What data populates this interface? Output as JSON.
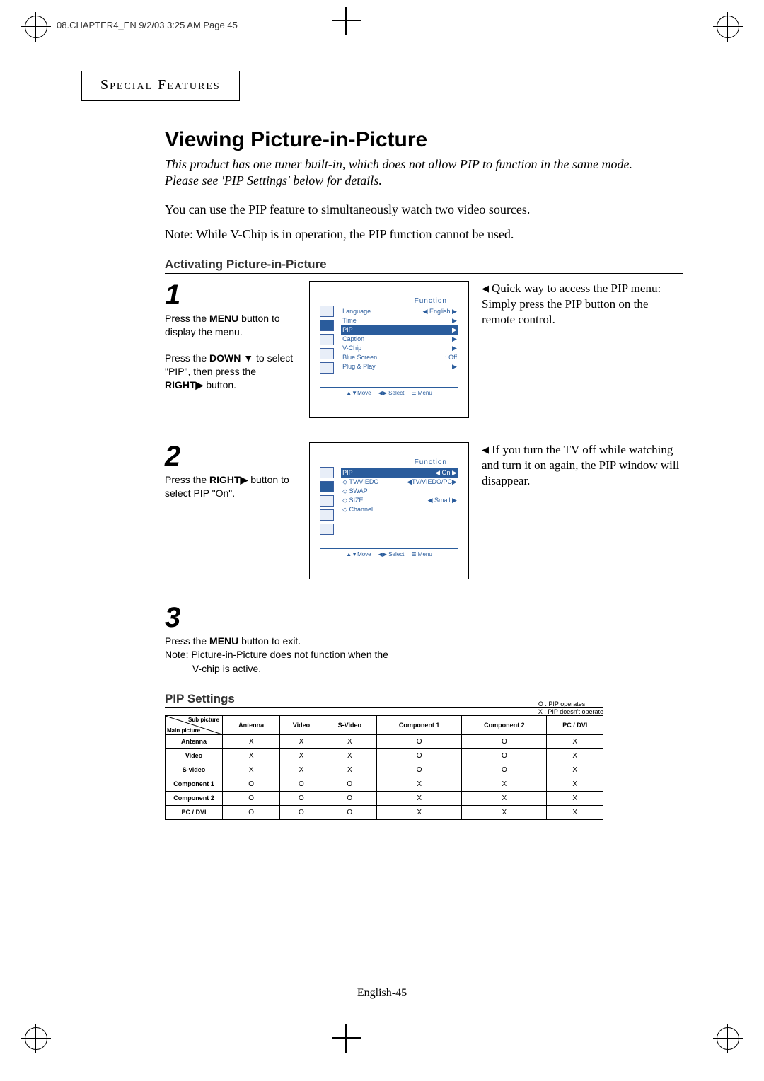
{
  "print_header": "08.CHAPTER4_EN  9/2/03 3:25 AM  Page 45",
  "section_label": "Special Features",
  "title": "Viewing Picture-in-Picture",
  "intro_italic": "This product has one tuner built-in, which does not allow PIP to function in the same mode. Please see 'PIP Settings' below for details.",
  "intro_1": "You can use the PIP feature to simultaneously watch two video sources.",
  "intro_2": "Note:  While V-Chip is in operation, the PIP function cannot be used.",
  "subhead_activate": "Activating Picture-in-Picture",
  "step1": {
    "num": "1",
    "text_a": "Press the ",
    "bold_a": "MENU",
    "text_b": " button to display the menu.",
    "text_c": "Press the ",
    "bold_c": "DOWN ▼",
    "text_d": "to select \"PIP\", then press the ",
    "bold_d": "RIGHT▶",
    "text_e": " button.",
    "osd_title": "Function",
    "osd_rows": [
      {
        "l": "Language",
        "r": "◀ English ▶"
      },
      {
        "l": "Time",
        "r": "▶"
      },
      {
        "l": "PIP",
        "r": "▶",
        "sel": true
      },
      {
        "l": "Caption",
        "r": "▶"
      },
      {
        "l": "V-Chip",
        "r": "▶"
      },
      {
        "l": "Blue Screen",
        "r": ": Off"
      },
      {
        "l": "Plug & Play",
        "r": "▶"
      }
    ],
    "osd_footer": {
      "a": "▲▼Move",
      "b": "◀▶ Select",
      "c": "☰ Menu"
    }
  },
  "tip1": "Quick way to access the PIP menu: Simply press the PIP button on the remote control.",
  "step2": {
    "num": "2",
    "text_a": "Press the ",
    "bold_a": "RIGHT▶",
    "text_b": " button to select PIP \"On\".",
    "osd_title": "Function",
    "osd_rows": [
      {
        "l": "PIP",
        "r": "◀   On   ▶",
        "sel": true
      },
      {
        "l": "◇ TV/VIEDO",
        "r": "◀TV/VIEDO/PC▶"
      },
      {
        "l": "◇ SWAP",
        "r": ""
      },
      {
        "l": "◇ SIZE",
        "r": "◀   Small   ▶"
      },
      {
        "l": "◇ Channel",
        "r": ""
      }
    ],
    "osd_footer": {
      "a": "▲▼Move",
      "b": "◀▶ Select",
      "c": "☰ Menu"
    }
  },
  "tip2": "If you turn the TV off while watching and turn it on again, the PIP window will disappear.",
  "step3": {
    "num": "3",
    "line1_a": "Press the ",
    "line1_bold": "MENU",
    "line1_b": " button to exit.",
    "line2": "Note: Picture-in-Picture does not function when the",
    "line3": "          V-chip is active."
  },
  "subhead_settings": "PIP Settings",
  "legend_o": "O :   PIP operates",
  "legend_x": "X :   PIP doesn't operate",
  "table": {
    "corner_sub": "Sub picture",
    "corner_main": "Main picture",
    "cols": [
      "Antenna",
      "Video",
      "S-Video",
      "Component 1",
      "Component 2",
      "PC / DVI"
    ],
    "rows": [
      {
        "h": "Antenna",
        "c": [
          "X",
          "X",
          "X",
          "O",
          "O",
          "X"
        ]
      },
      {
        "h": "Video",
        "c": [
          "X",
          "X",
          "X",
          "O",
          "O",
          "X"
        ]
      },
      {
        "h": "S-video",
        "c": [
          "X",
          "X",
          "X",
          "O",
          "O",
          "X"
        ]
      },
      {
        "h": "Component 1",
        "c": [
          "O",
          "O",
          "O",
          "X",
          "X",
          "X"
        ]
      },
      {
        "h": "Component 2",
        "c": [
          "O",
          "O",
          "O",
          "X",
          "X",
          "X"
        ]
      },
      {
        "h": "PC / DVI",
        "c": [
          "O",
          "O",
          "O",
          "X",
          "X",
          "X"
        ]
      }
    ]
  },
  "page_footer": "English-45"
}
